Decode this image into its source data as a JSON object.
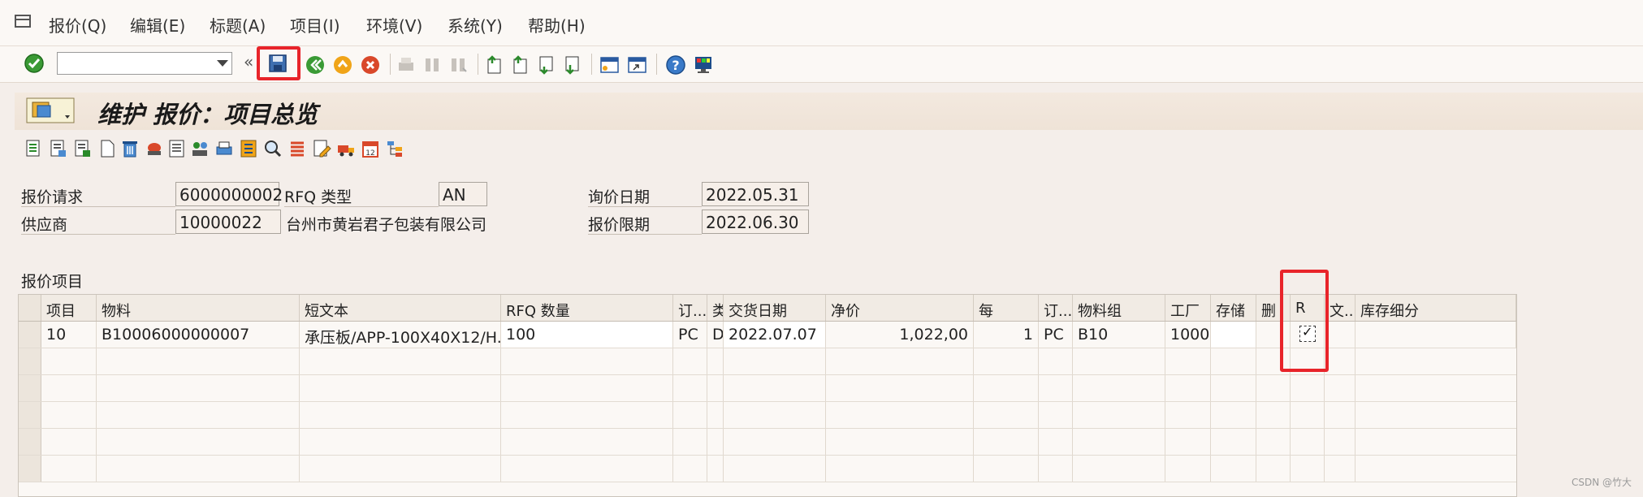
{
  "menu": {
    "items": [
      "报价(Q)",
      "编辑(E)",
      "标题(A)",
      "项目(I)",
      "环境(V)",
      "系统(Y)",
      "帮助(H)"
    ]
  },
  "toolbar": {
    "command_field_value": "",
    "icons": [
      "check-icon",
      "save-icon",
      "back-icon",
      "exit-icon",
      "cancel-icon",
      "print-icon",
      "find-icon",
      "find-next-icon",
      "first-page-icon",
      "prev-page-icon",
      "next-page-icon",
      "last-page-icon",
      "create-session-icon",
      "shortcut-icon",
      "help-icon",
      "customize-layout-icon"
    ]
  },
  "title": "维护 报价：项目总览",
  "header": {
    "rfq_label": "报价请求",
    "rfq_value": "6000000002",
    "rfq_type_label": "RFQ 类型",
    "rfq_type_value": "AN",
    "vendor_label": "供应商",
    "vendor_value": "10000022",
    "vendor_name": "台州市黄岩君子包装有限公司",
    "inquiry_date_label": "询价日期",
    "inquiry_date_value": "2022.05.31",
    "quote_deadline_label": "报价限期",
    "quote_deadline_value": "2022.06.30"
  },
  "items_section_label": "报价项目",
  "table": {
    "columns": [
      "项目",
      "物料",
      "短文本",
      "RFQ 数量",
      "订...",
      "类",
      "交货日期",
      "净价",
      "每",
      "订...",
      "物料组",
      "工厂",
      "存储",
      "删",
      "R",
      "文...",
      "库存细分"
    ],
    "rows": [
      {
        "item": "10",
        "material": "B10006000000007",
        "short_text": "承压板/APP-100X40X12/H...",
        "rfq_qty": "100",
        "order_unit": "PC",
        "category": "D",
        "delivery_date": "2022.07.07",
        "net_price": "1,022,00",
        "per": "1",
        "price_unit": "PC",
        "material_group": "B10",
        "plant": "1000",
        "storage": "",
        "deleted": "",
        "r_checked": "✓",
        "text": "",
        "stock_segment": ""
      }
    ]
  },
  "watermark": "CSDN @竹大",
  "colors": {
    "highlight": "#e8242a",
    "title_bg": "#f1e6da"
  }
}
